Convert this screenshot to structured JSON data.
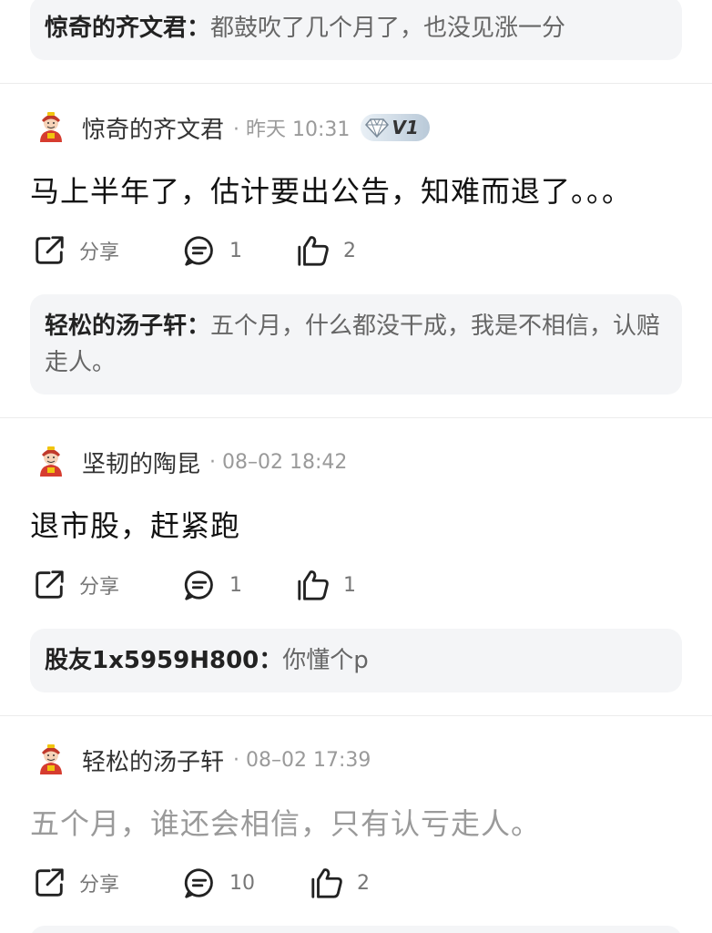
{
  "top_reply": {
    "name": "惊奇的齐文君：",
    "text": "都鼓吹了几个月了，也没见涨一分"
  },
  "posts": [
    {
      "user": "惊奇的齐文君",
      "time": "· 昨天 10:31",
      "badge": "V1",
      "text": "马上半年了，估计要出公告，知难而退了。。。",
      "share_label": "分享",
      "comment_count": "1",
      "like_count": "2",
      "reply": {
        "name": "轻松的汤子轩：",
        "text": "五个月，什么都没干成，我是不相信，认赔走人。"
      }
    },
    {
      "user": "坚韧的陶昆",
      "time": "· 08–02 18:42",
      "text": "退市股，赶紧跑",
      "share_label": "分享",
      "comment_count": "1",
      "like_count": "1",
      "reply": {
        "name": "股友1x5959H800：",
        "text": "你懂个p"
      }
    },
    {
      "user": "轻松的汤子轩",
      "time": "· 08–02 17:39",
      "text": "五个月，谁还会相信，只有认亏走人。",
      "share_label": "分享",
      "comment_count": "10",
      "like_count": "2"
    }
  ],
  "icons": {
    "avatar": "fortune-god-avatar-icon",
    "share": "share-icon",
    "comment": "comment-icon",
    "like": "thumbs-up-icon",
    "badge": "diamond-icon"
  },
  "colors": {
    "reply_bg": "#f4f5f7",
    "muted": "#9a9a9a",
    "divider": "#ececec"
  }
}
